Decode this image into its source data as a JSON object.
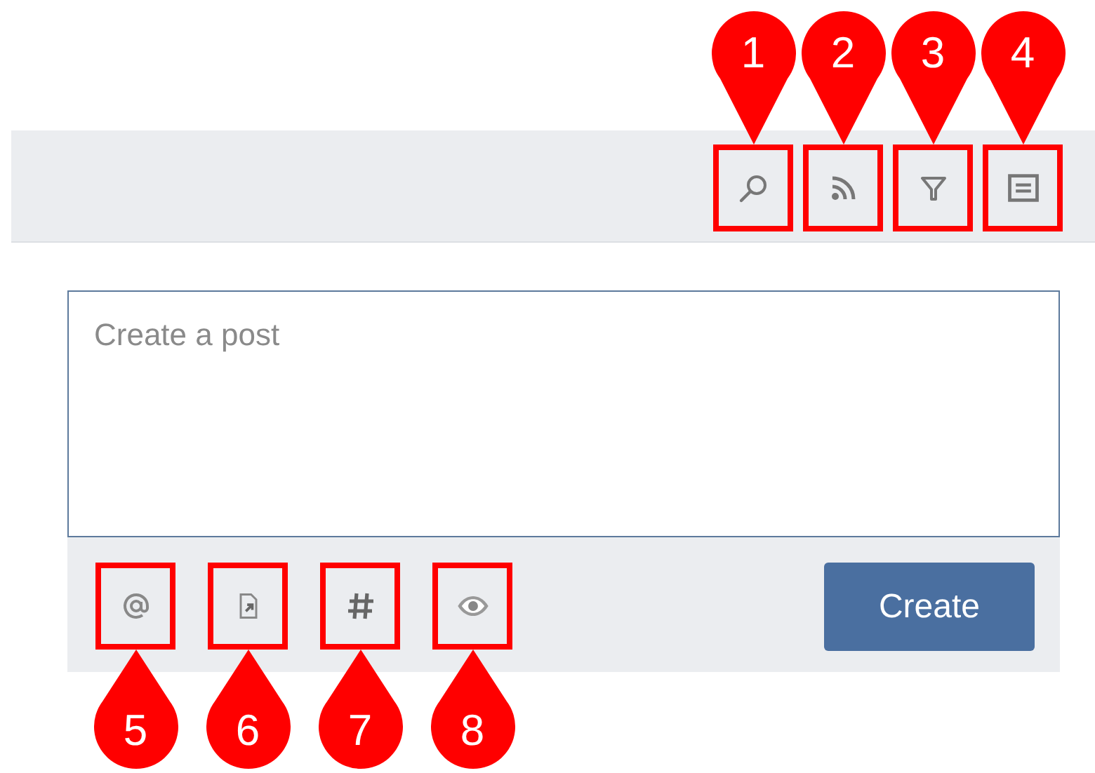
{
  "toolbar": {
    "buttons": [
      {
        "kind": "search",
        "callout": "1"
      },
      {
        "kind": "feed",
        "callout": "2"
      },
      {
        "kind": "filter",
        "callout": "3"
      },
      {
        "kind": "list",
        "callout": "4"
      }
    ]
  },
  "composer": {
    "placeholder": "Create a post",
    "tools": [
      {
        "kind": "mention",
        "callout": "5"
      },
      {
        "kind": "attachment",
        "callout": "6"
      },
      {
        "kind": "hashtag",
        "callout": "7"
      },
      {
        "kind": "preview",
        "callout": "8"
      }
    ],
    "submit": "Create"
  }
}
